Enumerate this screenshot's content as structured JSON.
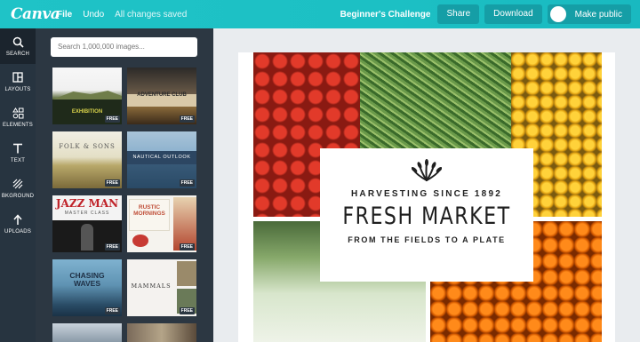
{
  "topbar": {
    "logo": "Canva",
    "file": "File",
    "undo": "Undo",
    "save_status": "All changes saved",
    "project_title": "Beginner's Challenge",
    "share": "Share",
    "download": "Download",
    "make_public": "Make public",
    "accent": "#1fc3c7"
  },
  "nav": {
    "items": [
      {
        "label": "SEARCH",
        "icon": "search-icon"
      },
      {
        "label": "LAYOUTS",
        "icon": "layouts-icon"
      },
      {
        "label": "ELEMENTS",
        "icon": "elements-icon"
      },
      {
        "label": "TEXT",
        "icon": "text-icon"
      },
      {
        "label": "BKGROUND",
        "icon": "background-icon"
      },
      {
        "label": "UPLOADS",
        "icon": "uploads-icon"
      }
    ]
  },
  "panel": {
    "search_placeholder": "Search 1,000,000 images...",
    "free_badge": "FREE",
    "thumbs": [
      {
        "title": "EXHIBITION"
      },
      {
        "title": "ADVENTURE CLUB"
      },
      {
        "title": "FOLK & SONS"
      },
      {
        "title": "NAUTICAL OUTLOOK"
      },
      {
        "title": "JAZZ MAN",
        "subtitle": "MASTER CLASS"
      },
      {
        "title": "RUSTIC MORNINGS"
      },
      {
        "title": "CHASING WAVES"
      },
      {
        "title": "MAMMALS"
      }
    ]
  },
  "design": {
    "tagline_top": "HARVESTING SINCE 1892",
    "headline": "FRESH MARKET",
    "tagline_bottom": "FROM THE FIELDS TO A PLATE"
  }
}
